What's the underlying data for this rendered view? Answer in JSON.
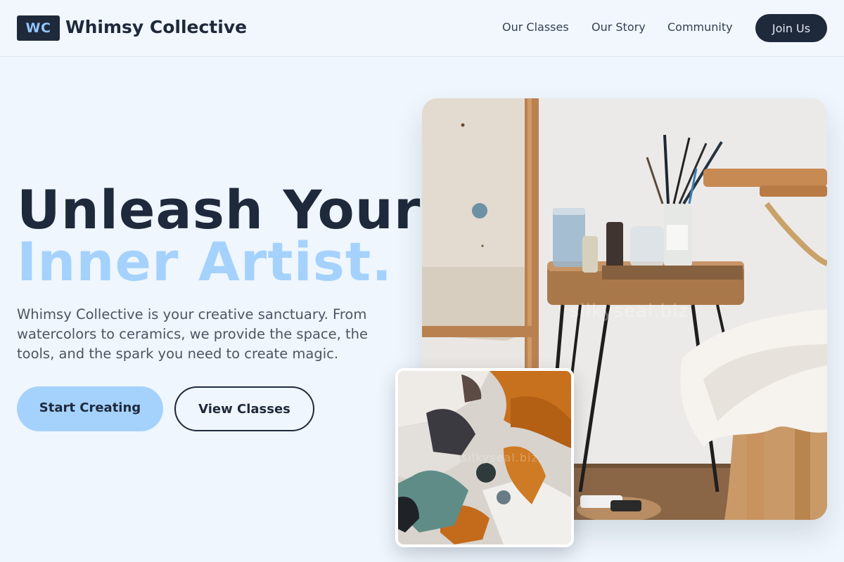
{
  "brand": {
    "logo_initials": "WC",
    "name": "Whimsy Collective"
  },
  "nav": {
    "items": [
      {
        "label": "Our Classes"
      },
      {
        "label": "Our Story"
      },
      {
        "label": "Community"
      }
    ],
    "cta_label": "Join Us"
  },
  "hero": {
    "title_line1": "Unleash Your",
    "title_line2": "Inner Artist.",
    "description": "Whimsy Collective is your creative sanctuary. From watercolors to ceramics, we provide the space, the tools, and the spark you need to create magic.",
    "primary_button": "Start Creating",
    "secondary_button": "View Classes"
  },
  "images": {
    "main_watermark": "silkyseal.biz",
    "accent_watermark": "silkyseal.biz"
  },
  "colors": {
    "background": "#eff6fd",
    "dark": "#1e293b",
    "accent_light_blue": "#a5d2fd"
  }
}
